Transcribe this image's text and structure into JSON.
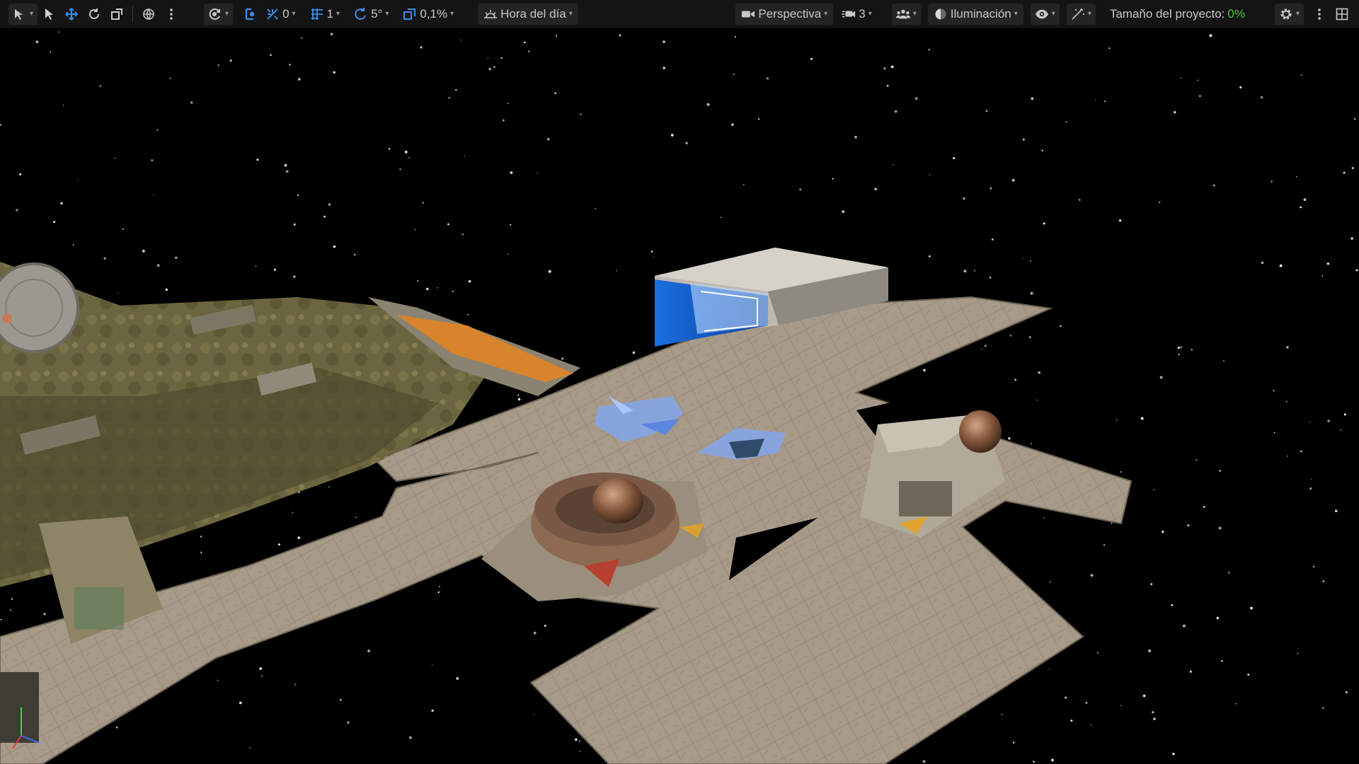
{
  "toolbar": {
    "snap_translate_value": "0",
    "grid_value": "1",
    "rotation_value": "5°",
    "scale_value": "0,1%",
    "time_of_day_label": "Hora del día",
    "view_mode_label": "Perspectiva",
    "camera_speed_value": "3",
    "lighting_label": "Iluminación",
    "project_size_label": "Tamaño del proyecto:",
    "project_size_value": "0%"
  },
  "colors": {
    "toolbar_bg": "#141414",
    "accent_blue": "#3b8eea",
    "accent_green": "#3fcf3f",
    "floor_tile": "#a89a88",
    "sky": "#000000"
  },
  "icons": [
    "select-mode-icon",
    "arrow-select-icon",
    "translate-icon",
    "rotate-icon",
    "scale-icon",
    "world-local-icon",
    "more-options-icon",
    "surface-snap-icon",
    "snap-translate-icon",
    "grid-snap-icon",
    "rotation-snap-icon",
    "scale-snap-icon",
    "sun-icon",
    "camera-icon",
    "camera-speed-icon",
    "users-icon",
    "lighting-sphere-icon",
    "eye-icon",
    "sparkle-icon",
    "gear-icon",
    "kebab-icon",
    "layout-icon"
  ]
}
